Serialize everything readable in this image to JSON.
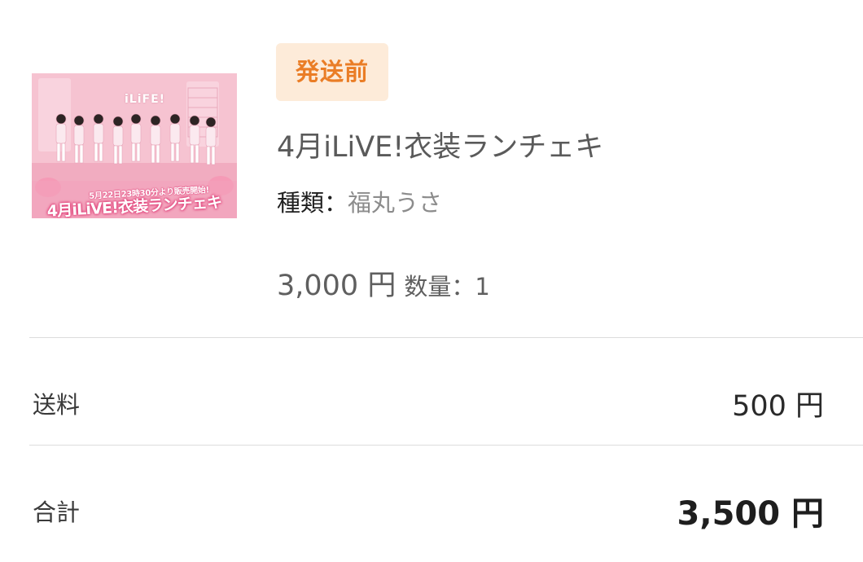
{
  "product": {
    "image": {
      "description_icon": "product-photo",
      "sign_text": "iLiFE!",
      "caption_line_1": "5月22日23時30分より販売開始!",
      "caption_line_2": "4月iLiVE!衣装ランチェキ"
    },
    "status_badge": "発送前",
    "title": "4月iLiVE!衣装ランチェキ",
    "variant_label": "種類：",
    "variant_value": "福丸うさ",
    "price": "3,000 円",
    "quantity": "数量：1"
  },
  "summary": {
    "shipping_label": "送料",
    "shipping_value": "500 円",
    "total_label": "合計",
    "total_value": "3,500 円"
  },
  "colors": {
    "badge_bg": "#fdebd9",
    "badge_text": "#ea7d26",
    "divider": "#dcdcdc"
  }
}
